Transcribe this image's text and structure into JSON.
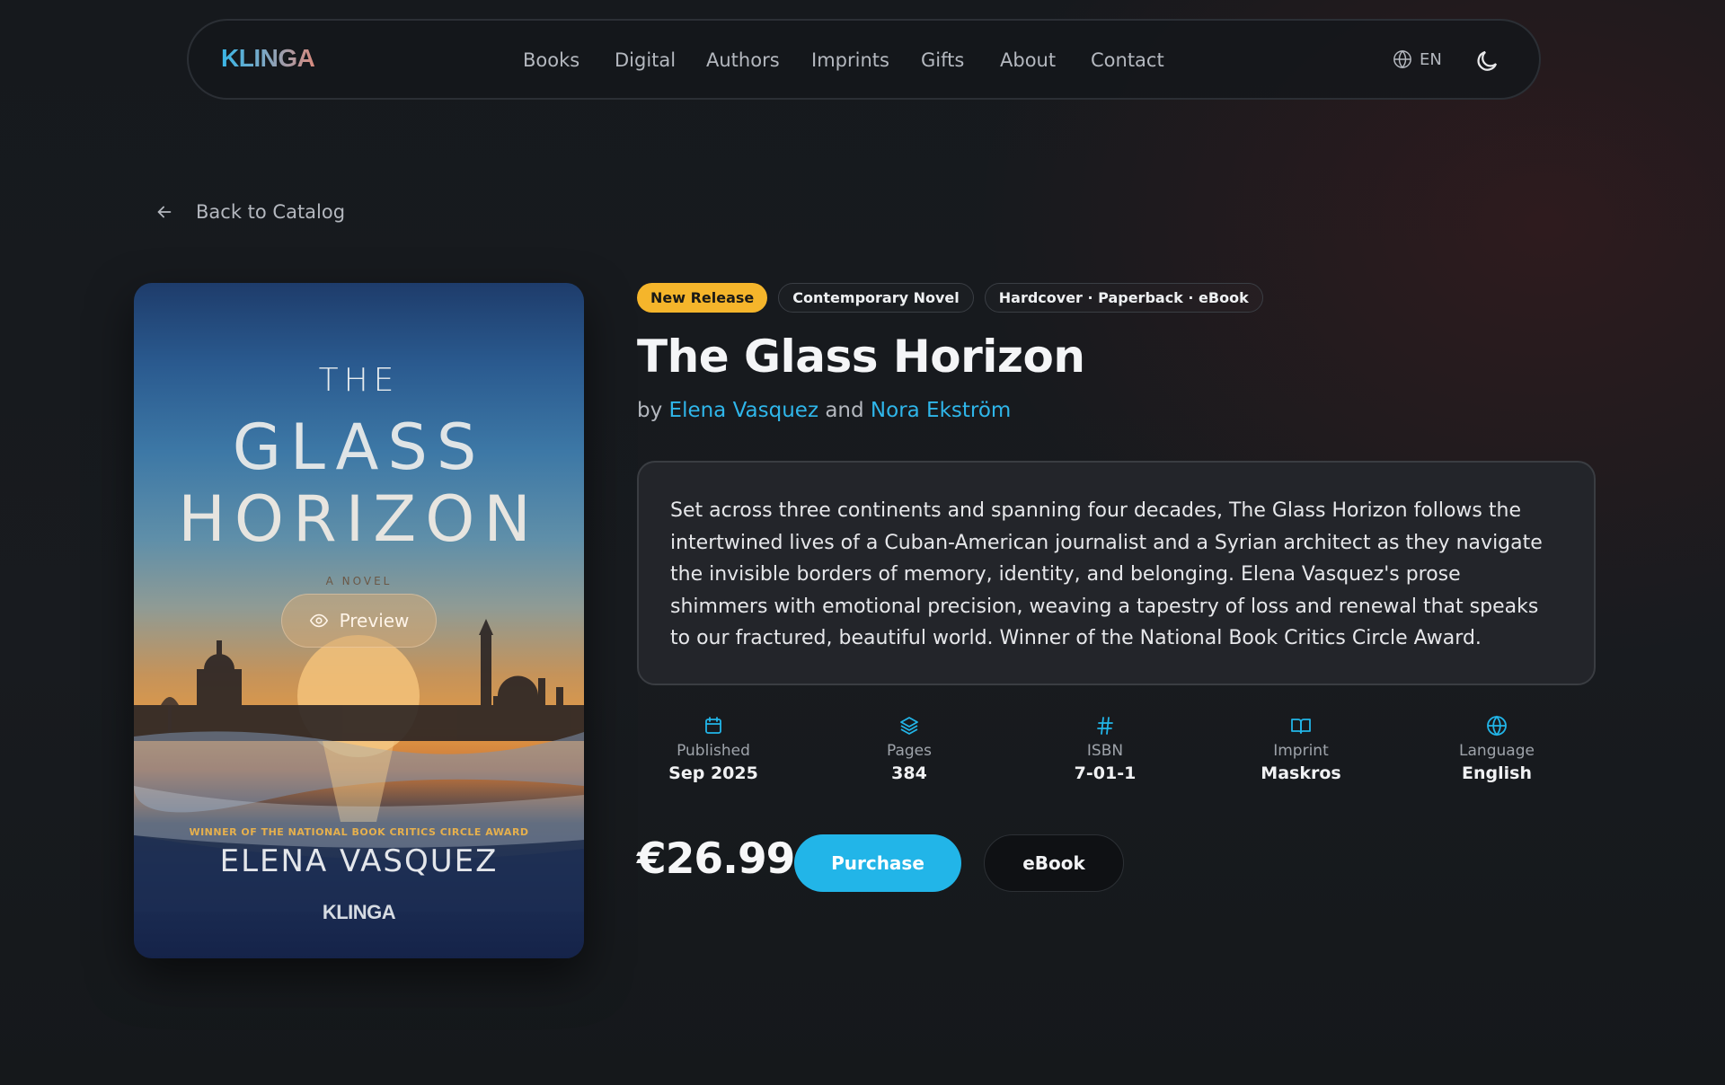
{
  "nav": {
    "logo": "KLINGA",
    "links": [
      "Books",
      "Digital",
      "Authors",
      "Imprints",
      "Gifts",
      "About",
      "Contact"
    ],
    "language": "EN"
  },
  "back": {
    "label": "Back to Catalog"
  },
  "cover": {
    "the": "THE",
    "glass": "GLASS",
    "horizon": "HORIZON",
    "novel": "A NOVEL",
    "award": "WINNER OF THE NATIONAL BOOK CRITICS CIRCLE AWARD",
    "author": "ELENA VASQUEZ",
    "publisher": "KLINGA",
    "preview_label": "Preview"
  },
  "book": {
    "badges": [
      "New Release",
      "Contemporary Novel",
      "Hardcover · Paperback · eBook"
    ],
    "title": "The Glass Horizon",
    "by": "by",
    "authors": [
      "Elena Vasquez",
      "Nora Ekström"
    ],
    "and": "and",
    "description": "Set across three continents and spanning four decades, The Glass Horizon follows the intertwined lives of a Cuban-American journalist and a Syrian architect as they navigate the invisible borders of memory, identity, and belonging. Elena Vasquez's prose shimmers with emotional precision, weaving a tapestry of loss and renewal that speaks to our fractured, beautiful world. Winner of the National Book Critics Circle Award.",
    "meta": [
      {
        "icon": "calendar-icon",
        "label": "Published",
        "value": "Sep 2025"
      },
      {
        "icon": "layers-icon",
        "label": "Pages",
        "value": "384"
      },
      {
        "icon": "hash-icon",
        "label": "ISBN",
        "value": "7-01-1"
      },
      {
        "icon": "book-open-icon",
        "label": "Imprint",
        "value": "Maskros"
      },
      {
        "icon": "globe-icon",
        "label": "Language",
        "value": "English"
      }
    ],
    "price": "€26.99",
    "purchase_label": "Purchase",
    "ebook_label": "eBook"
  },
  "colors": {
    "accent": "#22b5e8",
    "badge_new": "#f5b52b",
    "background": "#171a1e"
  }
}
